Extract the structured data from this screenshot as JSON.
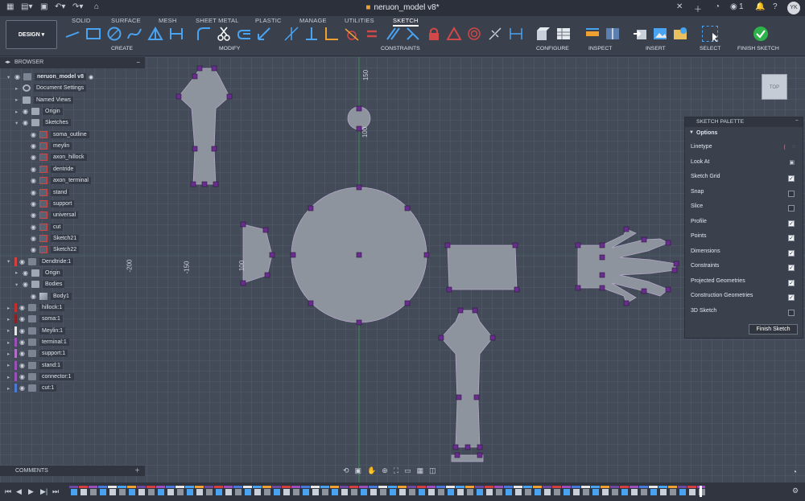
{
  "window": {
    "title": "neruon_model v8*",
    "notification_count": "1",
    "user_initials": "YK"
  },
  "ribbon": {
    "tabs": [
      "SOLID",
      "SURFACE",
      "MESH",
      "SHEET METAL",
      "PLASTIC",
      "MANAGE",
      "UTILITIES",
      "SKETCH"
    ],
    "active_tab": "SKETCH",
    "workspace": "DESIGN",
    "groups": [
      "CREATE",
      "MODIFY",
      "CONSTRAINTS",
      "CONFIGURE",
      "INSPECT",
      "INSERT",
      "SELECT",
      "FINISH SKETCH"
    ]
  },
  "browser": {
    "title": "BROWSER",
    "items": [
      {
        "label": "neruon_model v8",
        "icon": "document-icon",
        "level": 0,
        "expanded": true
      },
      {
        "label": "Document Settings",
        "icon": "gear-icon",
        "level": 1
      },
      {
        "label": "Named Views",
        "icon": "folder-icon",
        "level": 1
      },
      {
        "label": "Origin",
        "icon": "folder-icon",
        "level": 1
      },
      {
        "label": "Sketches",
        "icon": "folder-icon",
        "level": 1,
        "expanded": true
      },
      {
        "label": "soma_outline",
        "icon": "sketch-icon",
        "level": 2
      },
      {
        "label": "meylin",
        "icon": "sketch-icon",
        "level": 2
      },
      {
        "label": "axon_hillock",
        "icon": "sketch-icon",
        "level": 2
      },
      {
        "label": "dentride",
        "icon": "sketch-icon",
        "level": 2
      },
      {
        "label": "axon_terminal",
        "icon": "sketch-icon",
        "level": 2
      },
      {
        "label": "stand",
        "icon": "sketch-icon",
        "level": 2
      },
      {
        "label": "support",
        "icon": "sketch-icon",
        "level": 2
      },
      {
        "label": "universal",
        "icon": "sketch-icon",
        "level": 2
      },
      {
        "label": "cut",
        "icon": "sketch-icon",
        "level": 2
      },
      {
        "label": "Sketch21",
        "icon": "sketch-icon",
        "level": 2
      },
      {
        "label": "Sketch22",
        "icon": "sketch-icon",
        "level": 2
      },
      {
        "label": "Dendtride:1",
        "icon": "component-icon",
        "level": 0,
        "expanded": true,
        "color": "#d24040"
      },
      {
        "label": "Origin",
        "icon": "folder-icon",
        "level": 1
      },
      {
        "label": "Bodies",
        "icon": "folder-icon",
        "level": 1,
        "expanded": true
      },
      {
        "label": "Body1",
        "icon": "body-icon",
        "level": 2
      },
      {
        "label": "hillock:1",
        "icon": "component-icon",
        "level": 0,
        "color": "#c03030"
      },
      {
        "label": "soma:1",
        "icon": "component-icon",
        "level": 0,
        "color": "#8a2222"
      },
      {
        "label": "Meylin:1",
        "icon": "component-icon",
        "level": 0,
        "color": "#e6e6e6"
      },
      {
        "label": "terminal:1",
        "icon": "component-icon",
        "level": 0,
        "color": "#9a50b8"
      },
      {
        "label": "support:1",
        "icon": "component-icon",
        "level": 0,
        "color": "#b070c8"
      },
      {
        "label": "stand:1",
        "icon": "component-icon",
        "level": 0,
        "color": "#9a50b8"
      },
      {
        "label": "connector:1",
        "icon": "component-icon",
        "level": 0,
        "color": "#9a50b8"
      },
      {
        "label": "cut:1",
        "icon": "component-icon",
        "level": 0,
        "color": "#4a7ad8"
      }
    ]
  },
  "canvas": {
    "axis_labels": [
      "150",
      "100",
      "-200",
      "-150",
      "100"
    ],
    "view_cube": "TOP"
  },
  "sketch_palette": {
    "title": "SKETCH PALETTE",
    "section": "Options",
    "rows": [
      {
        "label": "Linetype",
        "control": "icons"
      },
      {
        "label": "Look At",
        "control": "icon"
      },
      {
        "label": "Sketch Grid",
        "checked": true
      },
      {
        "label": "Snap",
        "checked": false
      },
      {
        "label": "Slice",
        "checked": false
      },
      {
        "label": "Profile",
        "checked": true
      },
      {
        "label": "Points",
        "checked": true
      },
      {
        "label": "Dimensions",
        "checked": true
      },
      {
        "label": "Constraints",
        "checked": true
      },
      {
        "label": "Projected Geometries",
        "checked": true
      },
      {
        "label": "Construction Geometries",
        "checked": true
      },
      {
        "label": "3D Sketch",
        "checked": false
      }
    ],
    "finish_label": "Finish Sketch"
  },
  "comments": {
    "title": "COMMENTS"
  },
  "colors": {
    "accent": "#3d9be9",
    "finish_green": "#2db34a",
    "sketch_fill": "#8e949e",
    "constraint_purple": "#6a2d8f"
  }
}
